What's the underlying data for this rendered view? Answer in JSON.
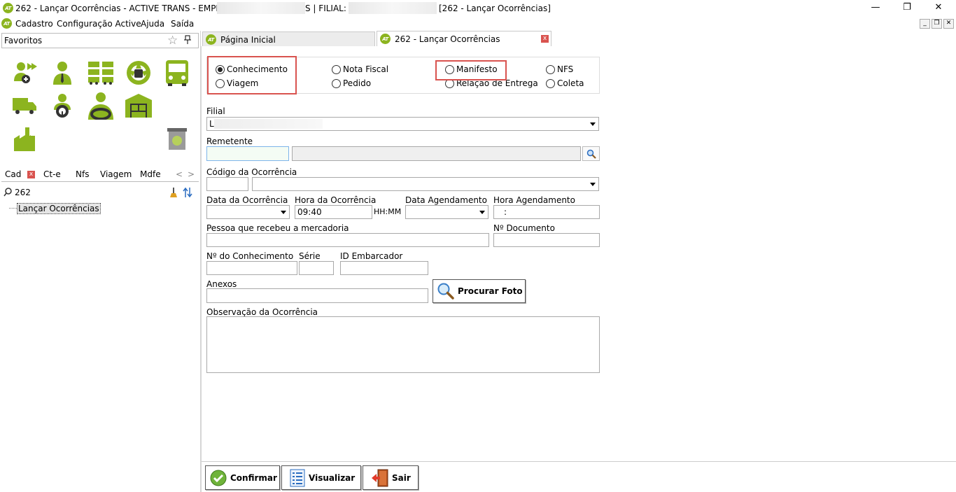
{
  "window": {
    "title_prefix": "262 - Lançar Ocorrências - ACTIVE TRANS - EMPRESA:",
    "title_mid": "S | FILIAL:",
    "title_suffix": "[262 - Lançar Ocorrências]",
    "logo_text": "AT",
    "minimize": "—",
    "restore": "❐",
    "close": "✕"
  },
  "menu": {
    "items": [
      "Cadastro",
      "Configuração Active",
      "Ajuda",
      "Saída"
    ],
    "mdi_minimize": "_",
    "mdi_restore": "❐",
    "mdi_close": "✕"
  },
  "favorites": {
    "title": "Favoritos",
    "star_icon": "☆",
    "pin_icon": "📌",
    "icons": [
      "user-arrow-icon",
      "person-tie-icon",
      "truck-fleet-icon",
      "steering-wheel-icon",
      "bus-front-icon",
      "delivery-truck-icon",
      "driver-icon",
      "driver-seat-icon",
      "warehouse-icon",
      "factory-icon",
      "recycle-bin-icon"
    ]
  },
  "cad_tabs": {
    "items": [
      "Cad",
      "Ct-e",
      "Nfs",
      "Viagem",
      "Mdfe"
    ],
    "close": "x",
    "prev": "<",
    "next": ">"
  },
  "search": {
    "value": "262"
  },
  "tree": {
    "item": "Lançar Ocorrências"
  },
  "tabs": {
    "home": "Página Inicial",
    "active": "262 - Lançar Ocorrências",
    "close": "x"
  },
  "radios": {
    "conhecimento": "Conhecimento",
    "viagem": "Viagem",
    "nota_fiscal": "Nota Fiscal",
    "pedido": "Pedido",
    "manifesto": "Manifesto",
    "relacao_entrega": "Relação de Entrega",
    "nfs": "NFS",
    "coleta": "Coleta",
    "selected": "conhecimento"
  },
  "form": {
    "filial_label": "Filial",
    "filial_value": "L",
    "remetente_label": "Remetente",
    "codigo_label": "Código da Ocorrência",
    "data_ocorrencia_label": "Data da Ocorrência",
    "hora_ocorrencia_label": "Hora da Ocorrência",
    "hora_ocorrencia_value": "09:40",
    "hhmm": "HH:MM",
    "data_agendamento_label": "Data Agendamento",
    "hora_agendamento_label": "Hora Agendamento",
    "hora_agendamento_value": ":",
    "pessoa_label": "Pessoa que recebeu a mercadoria",
    "documento_label": "Nº Documento",
    "conhecimento_label": "Nº do Conhecimento",
    "serie_label": "Série",
    "embarcador_label": "ID Embarcador",
    "anexos_label": "Anexos",
    "procurar_foto": "Procurar Foto",
    "observacao_label": "Observação da Ocorrência"
  },
  "actions": {
    "confirmar": "Confirmar",
    "visualizar": "Visualizar",
    "sair": "Sair"
  },
  "colors": {
    "brand_green": "#8cb41f",
    "highlight_red": "#d9534f"
  }
}
